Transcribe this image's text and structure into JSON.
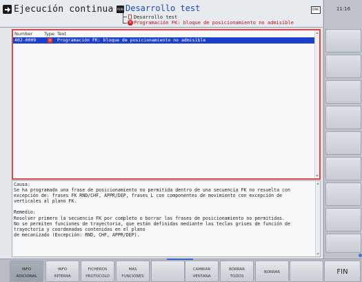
{
  "header": {
    "mode_title": "Ejecución continua",
    "program_title": "Desarrollo test",
    "program_icon_text": "RUN",
    "breadcrumb_item": "Desarrollo test",
    "breadcrumb_error": "Programación FK: bloque de posicionamiento no admisible",
    "dnc_label": "DNC"
  },
  "clock": "11:16",
  "list": {
    "columns": {
      "number": "Number",
      "type": "Type",
      "text": "Text"
    },
    "rows": [
      {
        "number": "402-0009",
        "type_icon": "error-icon",
        "text": "Programación FK: bloque de posicionamiento no admisible"
      }
    ]
  },
  "detail": {
    "lines": [
      "Causa:",
      "Se ha programado una frase de posicionamiento no permitida dentro de una secuencia FK no resuelta con",
      "excepción de:  frases FK RND/CHF, APPR/DEP, frases L con componentes de movimiento con excepción de",
      "verticales al plano FK.",
      "",
      "Remedio:",
      "Resolver primero la secuencia FK por completo o borrar las frases de posicionamiento no permitidas.",
      "No se permiten funciones de trayectoria, que están definidas mediante las teclas grises de función de",
      "trayectoria y coordenadas contenidas en el plano",
      "de mecanizado (Excepción: RND, CHF, APPR/DEP)."
    ]
  },
  "softkeys": {
    "info_adicional": {
      "l1": "INFO",
      "l2": "ADICIONAL"
    },
    "info_interna": {
      "l1": "INFO",
      "l2": "INTERNA"
    },
    "ficheros_protocolo": {
      "l1": "FICHEROS",
      "l2": "PROTOCOLO"
    },
    "mas_funciones": {
      "l1": "MAS",
      "l2": "FUNCIONES"
    },
    "cambiar_ventana": {
      "l1": "CAMBIAR",
      "l2": "VENTANA"
    },
    "borrar_todos": {
      "l1": "BORRAR",
      "l2": "TODOS"
    },
    "borrar": "BORRAR",
    "fin": "FIN"
  },
  "colors": {
    "selection": "#1e40c8",
    "error_border": "#d8484a",
    "program_title": "#1d49b8",
    "error_text": "#b41414"
  }
}
